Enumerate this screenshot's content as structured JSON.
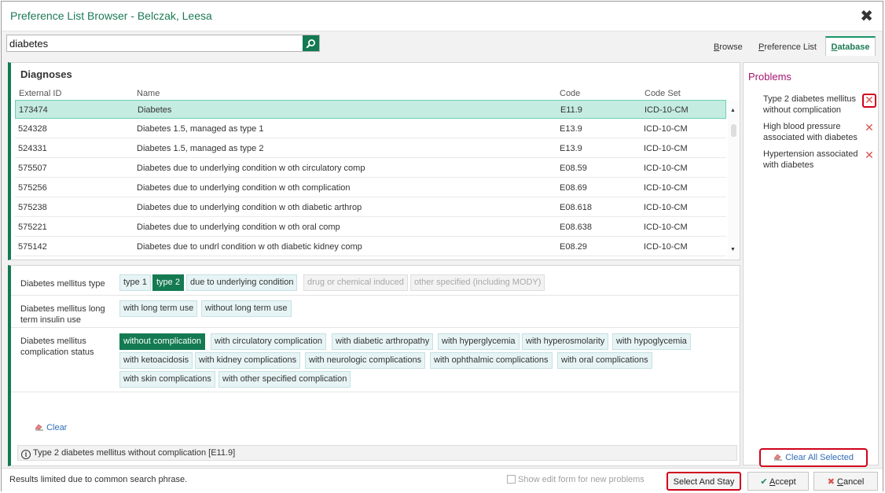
{
  "window": {
    "title": "Preference List Browser - Belczak, Leesa",
    "close_glyph": "✖"
  },
  "search": {
    "value": "diabetes",
    "button_icon": "search-icon"
  },
  "tabs": [
    {
      "label": "Browse",
      "underline": "B",
      "rest": "rowse"
    },
    {
      "label": "Preference List",
      "underline": "P",
      "rest": "reference List"
    },
    {
      "label": "Database",
      "underline": "D",
      "rest": "atabase"
    }
  ],
  "diagnoses": {
    "title": "Diagnoses",
    "columns": [
      "External ID",
      "Name",
      "Code",
      "Code Set"
    ],
    "rows": [
      {
        "id": "173474",
        "name": "Diabetes",
        "code": "E11.9",
        "set": "ICD-10-CM",
        "selected": true
      },
      {
        "id": "524328",
        "name": "Diabetes 1.5, managed as type 1",
        "code": "E13.9",
        "set": "ICD-10-CM"
      },
      {
        "id": "524331",
        "name": "Diabetes 1.5, managed as type 2",
        "code": "E13.9",
        "set": "ICD-10-CM"
      },
      {
        "id": "575507",
        "name": "Diabetes due to underlying condition w oth circulatory comp",
        "code": "E08.59",
        "set": "ICD-10-CM"
      },
      {
        "id": "575256",
        "name": "Diabetes due to underlying condition w oth complication",
        "code": "E08.69",
        "set": "ICD-10-CM"
      },
      {
        "id": "575238",
        "name": "Diabetes due to underlying condition w oth diabetic arthrop",
        "code": "E08.618",
        "set": "ICD-10-CM"
      },
      {
        "id": "575221",
        "name": "Diabetes due to underlying condition w oth oral comp",
        "code": "E08.638",
        "set": "ICD-10-CM"
      },
      {
        "id": "575142",
        "name": "Diabetes due to undrl condition w oth diabetic kidney comp",
        "code": "E08.29",
        "set": "ICD-10-CM"
      }
    ],
    "scroll_up": "▲",
    "scroll_down": "▼"
  },
  "attributes": {
    "type_label": "Diabetes mellitus type",
    "type_options": [
      {
        "label": "type 1",
        "state": "off"
      },
      {
        "label": "type 2",
        "state": "on"
      },
      {
        "label": "due to underlying condition",
        "state": "off"
      },
      {
        "label": "drug or chemical induced",
        "state": "disabled"
      },
      {
        "label": "other specified (including MODY)",
        "state": "disabled"
      }
    ],
    "insulin_label": "Diabetes mellitus long term insulin use",
    "insulin_options": [
      {
        "label": "with long term use",
        "state": "off"
      },
      {
        "label": "without long term use",
        "state": "off"
      }
    ],
    "status_label": "Diabetes mellitus complication status",
    "status_options": [
      {
        "label": "without complication",
        "state": "on"
      },
      {
        "label": "with circulatory complication",
        "state": "off"
      },
      {
        "label": "with diabetic arthropathy",
        "state": "off"
      },
      {
        "label": "with hyperglycemia",
        "state": "off"
      },
      {
        "label": "with hyperosmolarity",
        "state": "off"
      },
      {
        "label": "with hypoglycemia",
        "state": "off"
      },
      {
        "label": "with ketoacidosis",
        "state": "off"
      },
      {
        "label": "with kidney complications",
        "state": "off"
      },
      {
        "label": "with neurologic complications",
        "state": "off"
      },
      {
        "label": "with ophthalmic complications",
        "state": "off"
      },
      {
        "label": "with oral complications",
        "state": "off"
      },
      {
        "label": "with skin complications",
        "state": "off"
      },
      {
        "label": "with other specified complication",
        "state": "off"
      }
    ],
    "clear_label": "Clear",
    "summary": "Type 2 diabetes mellitus without complication [E11.9]"
  },
  "problems": {
    "title": "Problems",
    "items": [
      {
        "label": "Type 2 diabetes mellitus without complication"
      },
      {
        "label": "High blood pressure associated with diabetes"
      },
      {
        "label": "Hypertension associated with diabetes"
      }
    ],
    "remove_glyph": "✕",
    "clear_all_label": "Clear All Selected"
  },
  "footer": {
    "message": "Results limited due to common search phrase.",
    "checkbox_label": "Show edit form for new problems",
    "select_and_stay": "Select And Stay",
    "accept_u": "A",
    "accept_rest": "ccept",
    "cancel_u": "C",
    "cancel_rest": "ancel"
  },
  "colors": {
    "accent": "#137a52",
    "title_text": "#1c7a55",
    "problems_title": "#a3156e",
    "link": "#2f6db5",
    "highlight_border": "#d0021b",
    "selected_row": "#c5ece1"
  }
}
